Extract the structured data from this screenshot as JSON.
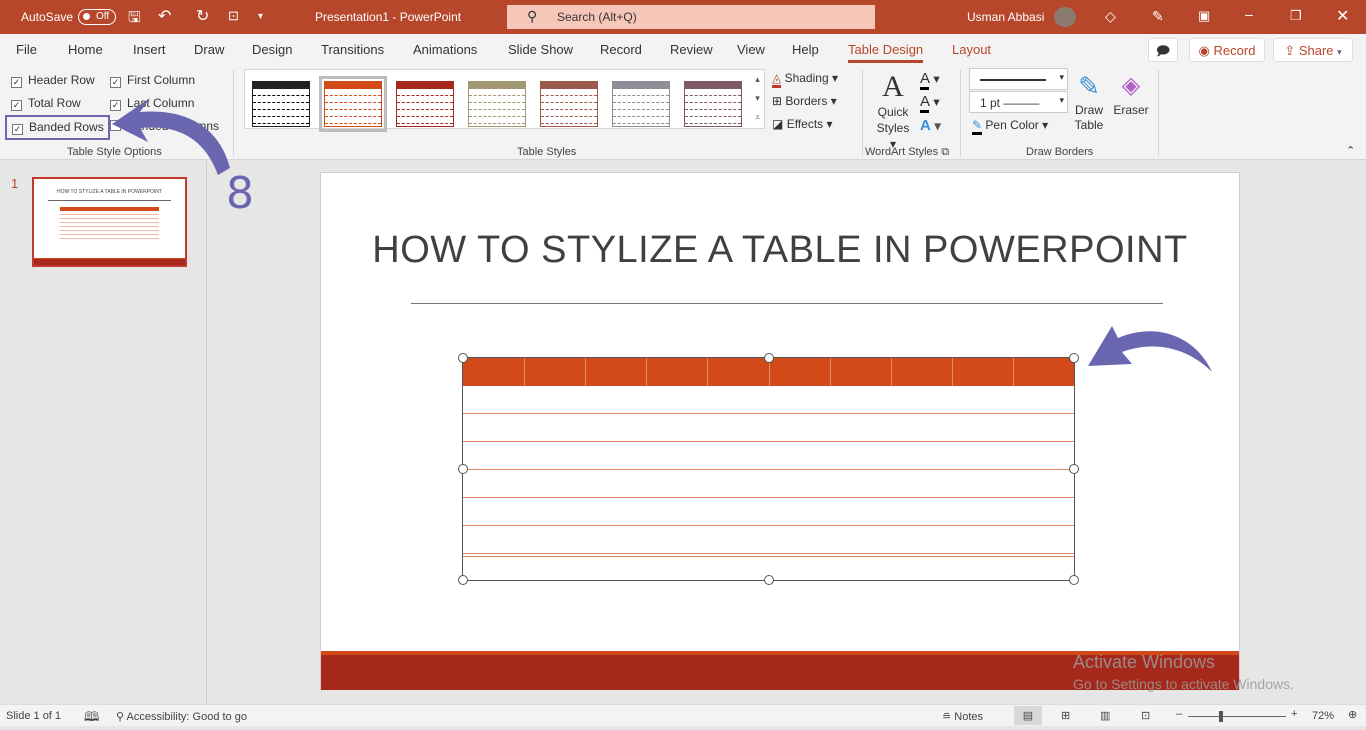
{
  "titlebar": {
    "autosave": "AutoSave",
    "autosave_state": "Off",
    "document_title": "Presentation1  -  PowerPoint",
    "search_placeholder": "Search (Alt+Q)",
    "user_name": "Usman Abbasi"
  },
  "tabs": [
    "File",
    "Home",
    "Insert",
    "Draw",
    "Design",
    "Transitions",
    "Animations",
    "Slide Show",
    "Record",
    "Review",
    "View",
    "Help",
    "Table Design",
    "Layout"
  ],
  "active_tab": "Table Design",
  "top_buttons": {
    "record": "Record",
    "share": "Share"
  },
  "table_style_options": {
    "label": "Table Style Options",
    "options": [
      {
        "label": "Header Row",
        "checked": true
      },
      {
        "label": "First Column",
        "checked": true
      },
      {
        "label": "Total Row",
        "checked": true
      },
      {
        "label": "Last Column",
        "checked": true
      },
      {
        "label": "Banded Rows",
        "checked": true
      },
      {
        "label": "Banded Columns",
        "checked": false
      }
    ]
  },
  "table_styles": {
    "label": "Table Styles",
    "swatches": [
      "#222222",
      "#d24a1a",
      "#a5281b",
      "#a39874",
      "#9b5a4b",
      "#8e8e98",
      "#7e5a66"
    ],
    "selected": 1,
    "shading": "Shading",
    "borders": "Borders",
    "effects": "Effects"
  },
  "wordart": {
    "label": "WordArt Styles",
    "quick_styles_1": "Quick",
    "quick_styles_2": "Styles"
  },
  "draw_borders": {
    "label": "Draw Borders",
    "pen_weight": "1 pt",
    "pen_color": "Pen Color",
    "draw_table_1": "Draw",
    "draw_table_2": "Table",
    "eraser": "Eraser"
  },
  "thumbnails": [
    {
      "number": "1",
      "title": "HOW TO STYLIZE A TABLE IN POWERPOINT"
    }
  ],
  "slide": {
    "title": "HOW TO STYLIZE A TABLE IN POWERPOINT",
    "table": {
      "columns": 10,
      "rows": 8,
      "header_color": "#d24a1a"
    }
  },
  "annotation": {
    "step": "8",
    "color": "#6a66b0"
  },
  "watermark": {
    "line1": "Activate Windows",
    "line2": "Go to Settings to activate Windows."
  },
  "status": {
    "slide": "Slide 1 of 1",
    "accessibility": "Accessibility: Good to go",
    "notes": "Notes",
    "zoom": "72%"
  }
}
